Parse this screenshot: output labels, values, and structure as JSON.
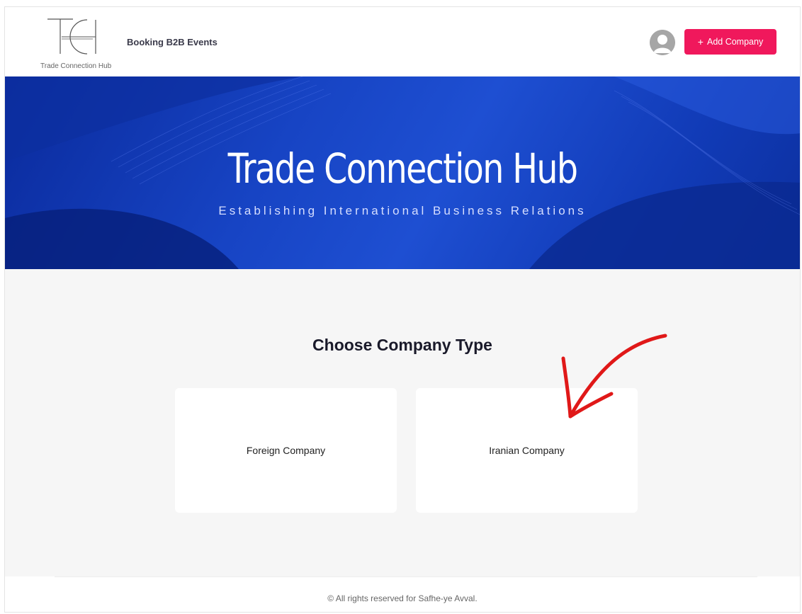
{
  "header": {
    "logo_text": "Trade Connection Hub",
    "nav_link": "Booking B2B Events",
    "add_button_icon": "+",
    "add_button_label": "Add Company"
  },
  "hero": {
    "title": "Trade Connection Hub",
    "subtitle": "Establishing International Business Relations"
  },
  "main": {
    "heading": "Choose Company Type",
    "cards": [
      {
        "label": "Foreign Company"
      },
      {
        "label": "Iranian Company"
      }
    ]
  },
  "footer": {
    "copyright": "© All rights reserved for Safhe-ye Avval."
  },
  "colors": {
    "accent": "#f0185c",
    "hero_blue": "#1744c4",
    "annotation_arrow": "#e01818"
  },
  "icons": [
    "logo-mark-icon",
    "avatar-icon",
    "plus-icon",
    "annotation-arrow-icon"
  ]
}
